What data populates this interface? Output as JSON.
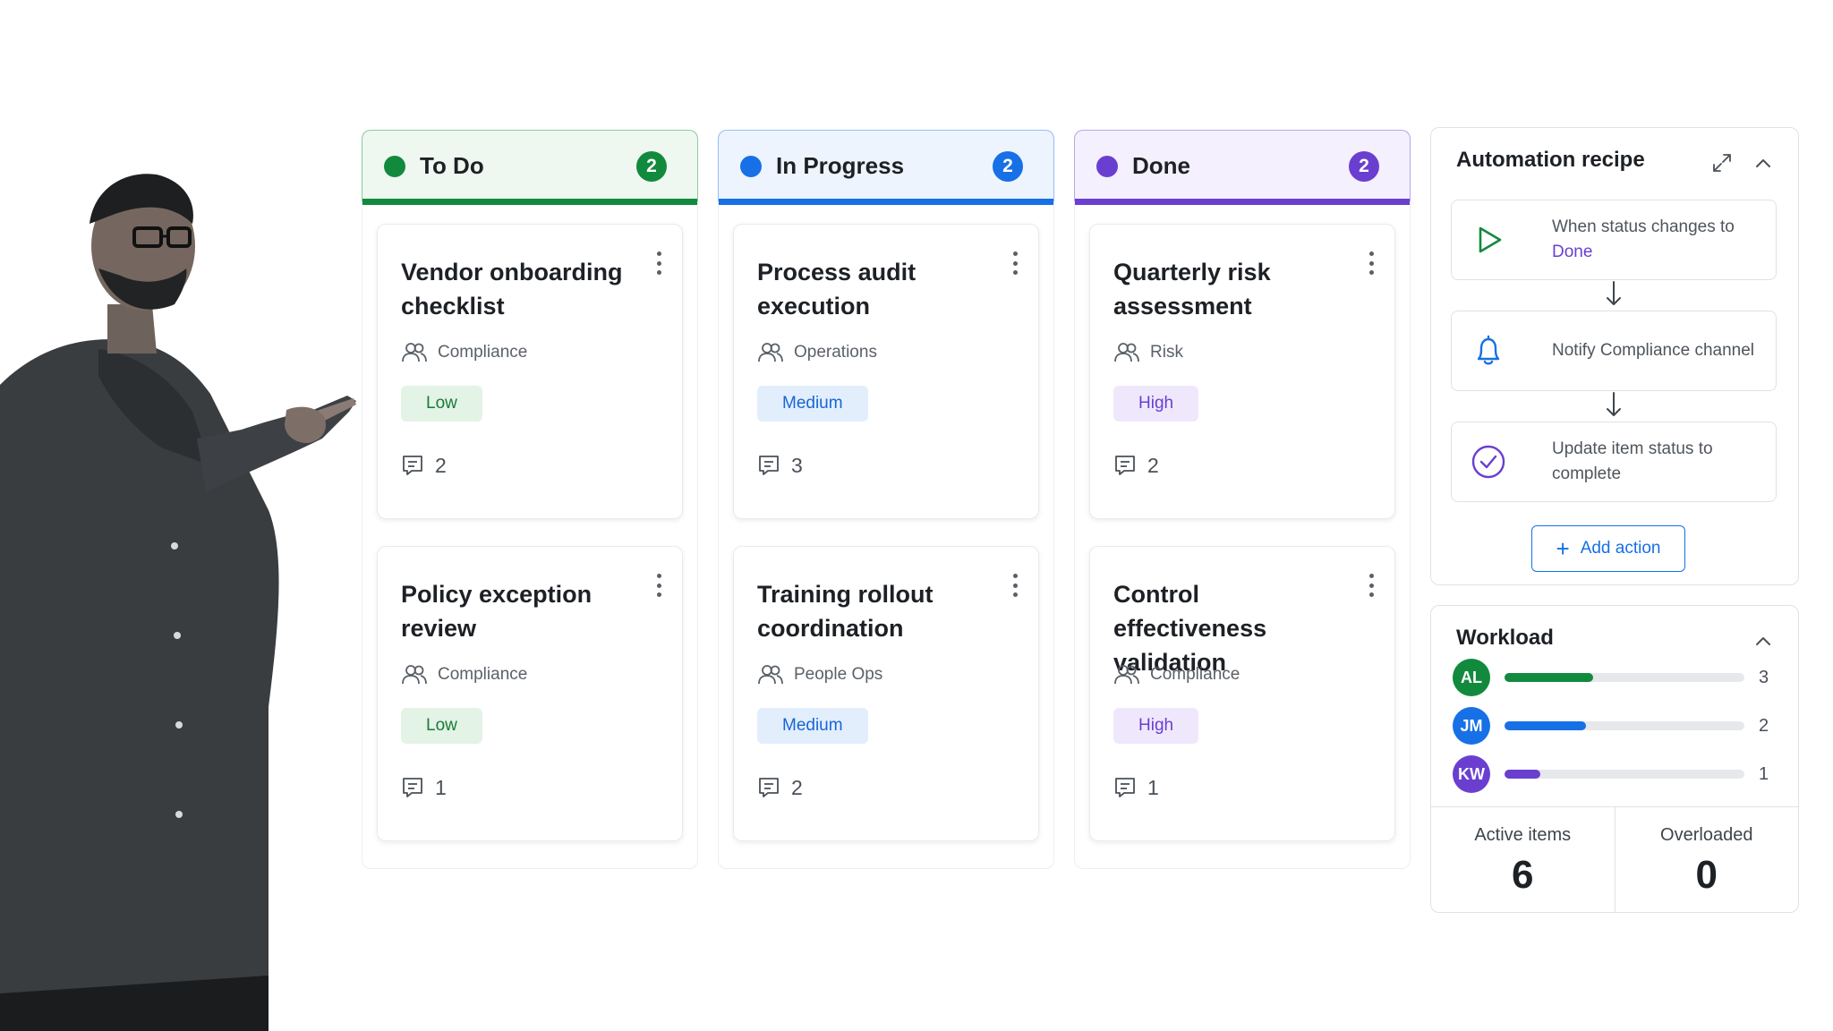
{
  "columns": [
    {
      "id": "todo",
      "title": "To Do",
      "count": "2",
      "accent": "#128a3e",
      "cards": [
        {
          "title": "Vendor onboarding checklist",
          "team": "Compliance",
          "priority": "Low",
          "comments": "2"
        },
        {
          "title": "Policy exception review",
          "team": "Compliance",
          "priority": "Low",
          "comments": "1"
        }
      ]
    },
    {
      "id": "progress",
      "title": "In Progress",
      "count": "2",
      "accent": "#1770e6",
      "cards": [
        {
          "title": "Process audit execution",
          "team": "Operations",
          "priority": "Medium",
          "comments": "3"
        },
        {
          "title": "Training rollout coordination",
          "team": "People Ops",
          "priority": "Medium",
          "comments": "2"
        }
      ]
    },
    {
      "id": "done",
      "title": "Done",
      "count": "2",
      "accent": "#6a3fd0",
      "cards": [
        {
          "title": "Quarterly risk assessment",
          "team": "Risk",
          "priority": "High",
          "comments": "2"
        },
        {
          "title": "Control effectiveness validation",
          "team": "Compliance",
          "priority": "High",
          "comments": "1"
        }
      ]
    }
  ],
  "automation": {
    "title": "Automation recipe",
    "steps": [
      {
        "icon": "play-icon",
        "text": "When status changes to ",
        "highlight": "Done"
      },
      {
        "icon": "bell-icon",
        "text": "Notify Compliance channel"
      },
      {
        "icon": "check-circle-icon",
        "text": "Update item status to complete"
      }
    ],
    "add_action_label": "Add action"
  },
  "workload": {
    "title": "Workload",
    "people": [
      {
        "initials": "AL",
        "count": "3",
        "load": 0.37,
        "color": "#128a3e"
      },
      {
        "initials": "JM",
        "count": "2",
        "load": 0.34,
        "color": "#1770e6"
      },
      {
        "initials": "KW",
        "count": "1",
        "load": 0.15,
        "color": "#6a3fd0"
      }
    ],
    "active_label": "Active items",
    "active_value": "6",
    "overloaded_label": "Overloaded",
    "overloaded_value": "0"
  }
}
